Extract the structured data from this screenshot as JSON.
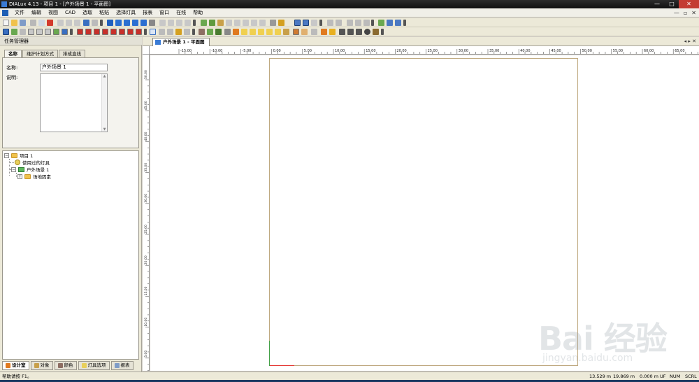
{
  "window": {
    "title": "DIALux 4.13 - 项目 1 - [户外场景 1 - 平面图]",
    "minimize_glyph": "—",
    "maximize_glyph": "□",
    "close_glyph": "✕"
  },
  "menu": {
    "items": [
      "文件",
      "编辑",
      "视图",
      "CAD",
      "选取",
      "粘贴",
      "选择灯具",
      "报表",
      "窗口",
      "在线",
      "帮助"
    ],
    "mdi_min": "—",
    "mdi_restore": "▫",
    "mdi_close": "✕"
  },
  "task_manager": {
    "header": "任务管理器",
    "tabs": [
      "名称",
      "维护计划方式",
      "排成直线"
    ],
    "name_label": "名称:",
    "name_value": "户外场景 1",
    "desc_label": "说明:",
    "scroll_up": "▲",
    "scroll_down": "▼"
  },
  "tree": {
    "root": "项目 1",
    "used_luminaires": "使用过的灯具",
    "scene": "户外场景 1",
    "ground_elements": "场地因素",
    "collapse_glyph": "−",
    "expand_glyph": "+"
  },
  "bottom_tabs": [
    "设计室",
    "对象",
    "颜色",
    "灯具选项",
    "报表"
  ],
  "document": {
    "tab_label": "户外场景 1 - 平面图",
    "nav_arrows": "◂ ▸ ✕"
  },
  "ruler": {
    "x_labels": [
      "-15.00",
      "-10.00",
      "-5.00",
      "0.00",
      "5.00",
      "10.00",
      "15.00",
      "20.00",
      "25.00",
      "30.00",
      "35.00",
      "40.00",
      "45.00",
      "50.00",
      "55.00",
      "60.00",
      "65.00"
    ],
    "y_labels": [
      "50.00",
      "45.00",
      "40.00",
      "35.00",
      "30.00",
      "25.00",
      "20.00",
      "15.00",
      "10.00",
      "5.00",
      "0.00"
    ]
  },
  "status": {
    "help": "帮助请按 F1。",
    "x_coord": "13.529 m",
    "y_coord": "19.869 m",
    "z_coord": "0.000 m",
    "uf": "UF",
    "num": "NUM",
    "scrl": "SCRL"
  },
  "watermark": {
    "main": "Bai 经验",
    "sub": "jingyan.baidu.com"
  }
}
